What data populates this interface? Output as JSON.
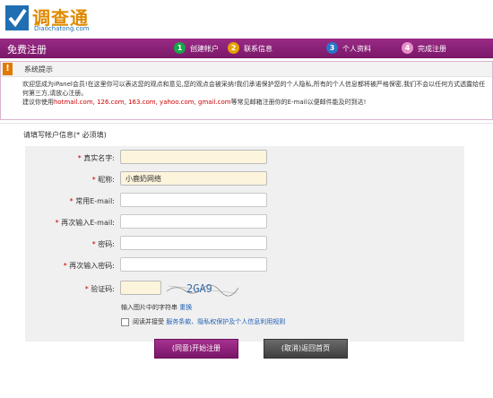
{
  "brand": {
    "name_cn": "调查通",
    "name_en": "Diaochatong.com"
  },
  "header": {
    "title": "免费注册",
    "steps": [
      {
        "num": "1",
        "label": "创建帐户",
        "color": "#1aa34a"
      },
      {
        "num": "2",
        "label": "联系信息",
        "color": "#e6a100"
      },
      {
        "num": "3",
        "label": "个人资料",
        "color": "#2a74c9"
      },
      {
        "num": "4",
        "label": "完成注册",
        "color": "#e78fc8"
      }
    ]
  },
  "notice": {
    "icon": "!",
    "title": "系统提示",
    "text_main": "欢迎您成为iPanel会员!在这里你可以表达您的观点和意见,您的观点会被采纳!我们承诺保护您的个人隐私,所有的个人信息都将被严格保密,我们不会以任何方式透露给任何第三方,请放心注册。",
    "text_pre": "建议你使用",
    "text_emails": "hotmail.com, 126.com, 163.com, yahoo.com, gmail.com",
    "text_post": "等常见邮箱注册你的E-mail以便邮件能及时到达!"
  },
  "form": {
    "section_title": "请填写帐户信息(* 必须填)",
    "fields": [
      {
        "label": "真实名字:",
        "value": ""
      },
      {
        "label": "昵称:",
        "value": "小鹿奶网络"
      },
      {
        "label": "常用E-mail:",
        "value": ""
      },
      {
        "label": "再次输入E-mail:",
        "value": ""
      },
      {
        "label": "密码:",
        "value": ""
      },
      {
        "label": "再次输入密码:",
        "value": ""
      }
    ],
    "captcha": {
      "label": "验证码:",
      "value": "",
      "image_text": "2GA9"
    },
    "refresh_text": "输入图片中的字符串",
    "refresh_link": "重换",
    "agree_text": "阅读并接受",
    "agree_link": "服务条款、隐私权保护及个人信息利用规则"
  },
  "buttons": {
    "register": "(同意)开始注册",
    "cancel": "(取消)返回首页"
  },
  "colors": {
    "header_bg": "#8a1f78",
    "input_bg": "#fdf4dc",
    "form_bg": "#f0f0f0"
  }
}
